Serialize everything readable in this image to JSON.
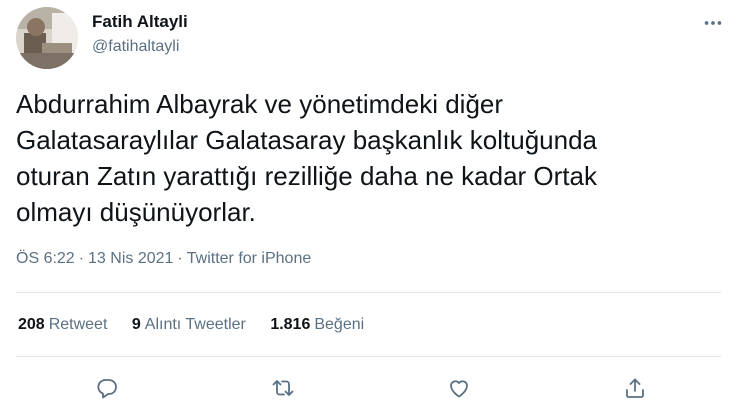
{
  "author": {
    "name": "Fatih Altayli",
    "handle": "@fatihaltayli"
  },
  "tweet": {
    "lines": [
      "Abdurrahim Albayrak ve yönetimdeki diğer",
      "Galatasaraylılar Galatasaray başkanlık koltuğunda",
      "oturan Zatın yarattığı rezilliğe daha ne kadar Ortak",
      "olmayı düşünüyorlar."
    ]
  },
  "meta": {
    "time": "ÖS 6:22",
    "date": "13 Nis 2021",
    "separator": "·",
    "source": "Twitter for iPhone"
  },
  "stats": {
    "retweets": {
      "count": "208",
      "label": "Retweet"
    },
    "quotes": {
      "count": "9",
      "label": "Alıntı Tweetler"
    },
    "likes": {
      "count": "1.816",
      "label": "Beğeni"
    }
  },
  "icons": {
    "more": "more-horizontal-icon",
    "reply": "reply-icon",
    "retweet": "retweet-icon",
    "like": "heart-icon",
    "share": "share-icon"
  },
  "colors": {
    "text": "#0f1419",
    "secondary": "#5b7083",
    "divider": "#e1e8ed"
  }
}
